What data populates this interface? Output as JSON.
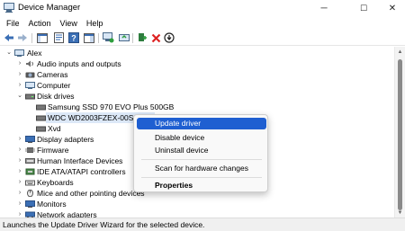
{
  "window": {
    "title": "Device Manager",
    "controls": {
      "minimize": "─",
      "maximize": "☐",
      "close": "✕"
    }
  },
  "menu": [
    "File",
    "Action",
    "View",
    "Help"
  ],
  "toolbar": {
    "icons": [
      "back-icon",
      "forward-icon",
      "show-hide-console-tree-icon",
      "properties-icon",
      "help-icon",
      "action-pane-icon",
      "scan-hardware-icon",
      "update-driver-icon",
      "uninstall-device-icon",
      "disable-device-icon"
    ]
  },
  "tree": {
    "root": "Alex",
    "items": [
      {
        "label": "Audio inputs and outputs",
        "icon": "speaker-icon"
      },
      {
        "label": "Cameras",
        "icon": "camera-icon"
      },
      {
        "label": "Computer",
        "icon": "computer-icon"
      },
      {
        "label": "Disk drives",
        "icon": "disk-drive-icon",
        "expanded": true
      },
      {
        "label": "Samsung SSD 970 EVO Plus 500GB",
        "icon": "disk-icon",
        "child": true
      },
      {
        "label": "WDC WD2003FZEX-00SRLA0",
        "icon": "disk-icon",
        "child": true,
        "selected": true
      },
      {
        "label": "Xvd",
        "icon": "disk-icon",
        "child": true
      },
      {
        "label": "Display adapters",
        "icon": "display-icon"
      },
      {
        "label": "Firmware",
        "icon": "firmware-icon"
      },
      {
        "label": "Human Interface Devices",
        "icon": "hid-icon"
      },
      {
        "label": "IDE ATA/ATAPI controllers",
        "icon": "ide-icon"
      },
      {
        "label": "Keyboards",
        "icon": "keyboard-icon"
      },
      {
        "label": "Mice and other pointing devices",
        "icon": "mouse-icon"
      },
      {
        "label": "Monitors",
        "icon": "monitor-icon"
      },
      {
        "label": "Network adapters",
        "icon": "network-icon"
      }
    ]
  },
  "context_menu": {
    "items": [
      "Update driver",
      "Disable device",
      "Uninstall device",
      "Scan for hardware changes",
      "Properties"
    ]
  },
  "status": "Launches the Update Driver Wizard for the selected device.",
  "colors": {
    "accent": "#1f5fd1",
    "selection": "#dce8f7",
    "status_bg": "#f0f0f0"
  }
}
